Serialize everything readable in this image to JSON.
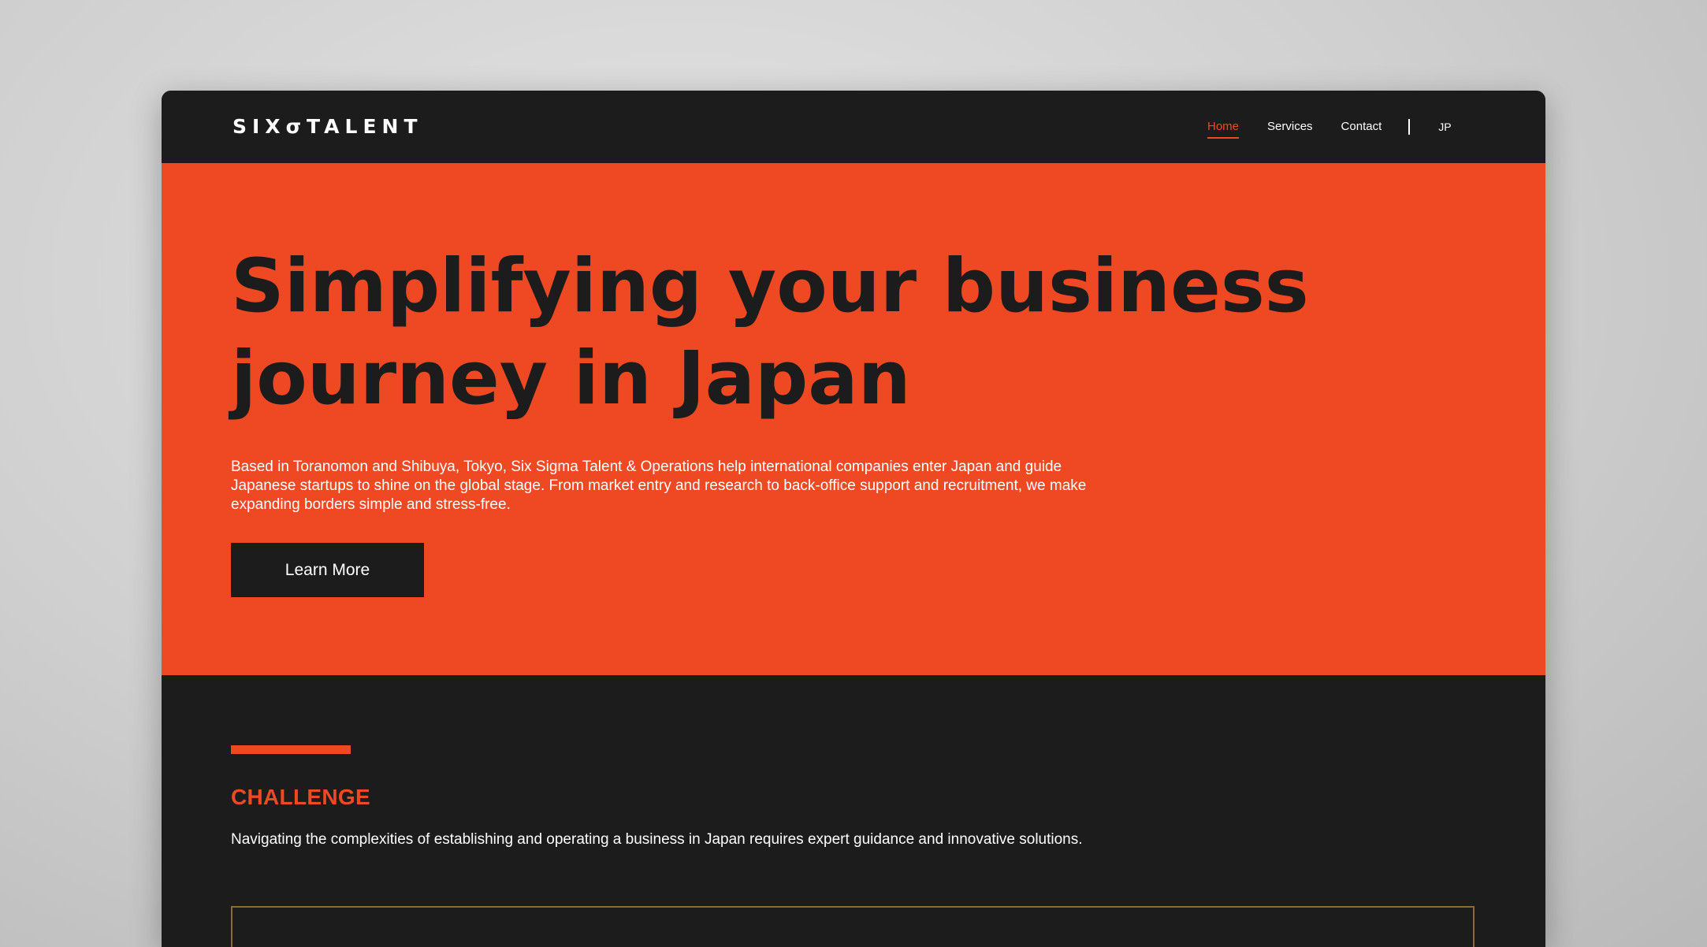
{
  "header": {
    "logo": "SIXσTALENT",
    "nav": {
      "home": "Home",
      "services": "Services",
      "contact": "Contact",
      "language": "JP"
    }
  },
  "hero": {
    "title": "Simplifying your business journey in Japan",
    "description": "Based in Toranomon and Shibuya, Tokyo, Six Sigma Talent & Operations help international companies enter Japan and guide Japanese startups to shine on the global stage. From market entry and research to back-office support and recruitment, we make expanding borders simple and stress-free.",
    "cta_label": "Learn More"
  },
  "challenge": {
    "title": "CHALLENGE",
    "description": "Navigating the complexities of establishing and operating a business in Japan requires expert guidance and innovative solutions."
  },
  "colors": {
    "accent": "#ee4923",
    "dark": "#1c1c1c",
    "text_light": "#ffffff",
    "card_border": "#8a6a3a"
  }
}
